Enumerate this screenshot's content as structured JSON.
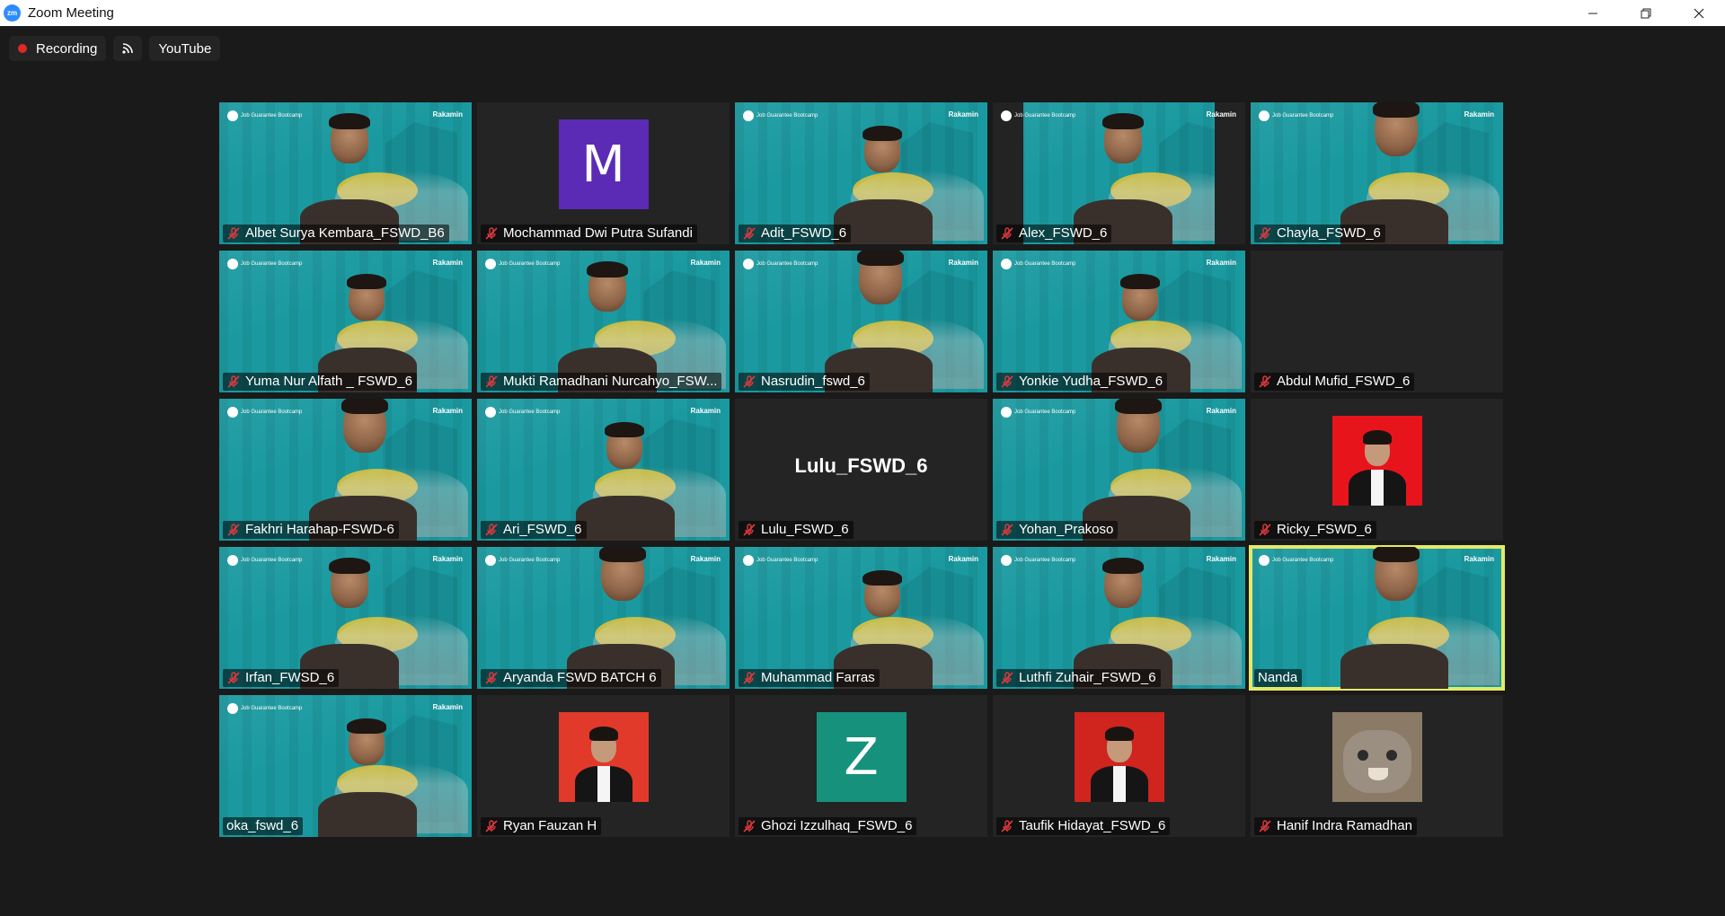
{
  "window": {
    "title": "Zoom Meeting",
    "app_icon_text": "zm",
    "controls": [
      "minimize-icon",
      "restore-icon",
      "close-icon"
    ]
  },
  "topbar": {
    "recording_label": "Recording",
    "stream_icon": "live-stream-icon",
    "youtube_label": "YouTube"
  },
  "background_brand": {
    "left": "Job Guarantee Bootcamp",
    "right": "Rakamin"
  },
  "participants": [
    {
      "name": "Albet Surya Kembara_FSWD_B6",
      "muted": true,
      "type": "video"
    },
    {
      "name": "Mochammad Dwi Putra Sufandi",
      "muted": true,
      "type": "avatar",
      "initial": "M",
      "color": "#5b2bb5"
    },
    {
      "name": "Adit_FSWD_6",
      "muted": true,
      "type": "video"
    },
    {
      "name": "Alex_FSWD_6",
      "muted": true,
      "type": "video-narrow"
    },
    {
      "name": "Chayla_FSWD_6",
      "muted": true,
      "type": "video"
    },
    {
      "name": "Yuma Nur Alfath _ FSWD_6",
      "muted": true,
      "type": "video"
    },
    {
      "name": "Mukti Ramadhani Nurcahyo_FSW...",
      "muted": true,
      "type": "video"
    },
    {
      "name": "Nasrudin_fswd_6",
      "muted": true,
      "type": "video"
    },
    {
      "name": "Yonkie Yudha_FSWD_6",
      "muted": true,
      "type": "video"
    },
    {
      "name": "Abdul Mufid_FSWD_6",
      "muted": true,
      "type": "blank"
    },
    {
      "name": "Fakhri Harahap-FSWD-6",
      "muted": true,
      "type": "video"
    },
    {
      "name": "Ari_FSWD_6",
      "muted": true,
      "type": "video"
    },
    {
      "name": "Lulu_FSWD_6",
      "muted": true,
      "type": "text",
      "display": "Lulu_FSWD_6"
    },
    {
      "name": "Yohan_Prakoso",
      "muted": true,
      "type": "video"
    },
    {
      "name": "Ricky_FSWD_6",
      "muted": true,
      "type": "photo",
      "color": "#e8141c"
    },
    {
      "name": "Irfan_FWSD_6",
      "muted": true,
      "type": "video"
    },
    {
      "name": "Aryanda FSWD BATCH 6",
      "muted": true,
      "type": "video"
    },
    {
      "name": "Muhammad Farras",
      "muted": true,
      "type": "video"
    },
    {
      "name": "Luthfi Zuhair_FSWD_6",
      "muted": true,
      "type": "video"
    },
    {
      "name": "Nanda",
      "muted": false,
      "type": "video",
      "active": true
    },
    {
      "name": "oka_fswd_6",
      "muted": false,
      "type": "video"
    },
    {
      "name": "Ryan Fauzan H",
      "muted": true,
      "type": "photo",
      "color": "#e23a2a"
    },
    {
      "name": "Ghozi Izzulhaq_FSWD_6",
      "muted": true,
      "type": "avatar",
      "initial": "Z",
      "color": "#16927c"
    },
    {
      "name": "Taufik Hidayat_FSWD_6",
      "muted": true,
      "type": "photo",
      "color": "#d0241f"
    },
    {
      "name": "Hanif Indra Ramadhan",
      "muted": true,
      "type": "photo-cat",
      "color": "#8b7b66"
    }
  ],
  "colors": {
    "meeting_bg": "#1a1a1a",
    "tile_bg": "#242424",
    "video_bg": "#1a9aa0",
    "active_speaker": "#e4e96a",
    "muted_icon": "#e0393e"
  }
}
